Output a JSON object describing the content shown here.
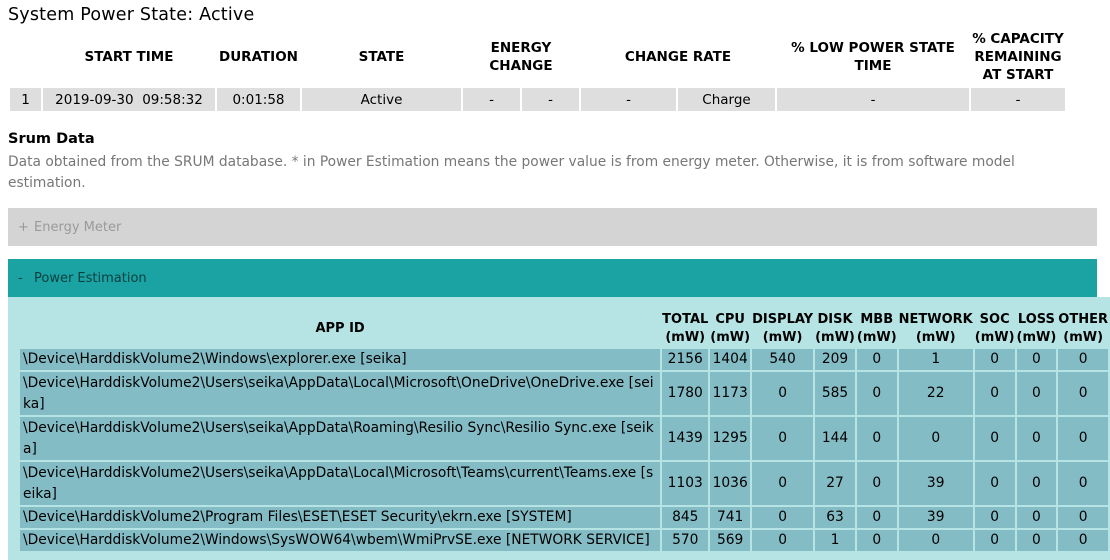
{
  "heading": "System Power State: Active",
  "state_table": {
    "columns": [
      "",
      "START TIME",
      "DURATION",
      "STATE",
      "ENERGY CHANGE",
      "",
      "CHANGE RATE",
      "",
      "% LOW POWER STATE TIME",
      "% CAPACITY REMAINING AT START"
    ],
    "row": {
      "index": "1",
      "start_time": "2019-09-30  09:58:32",
      "duration": "0:01:58",
      "state": "Active",
      "energy_change_a": "-",
      "energy_change_b": "-",
      "change_rate_a": "-",
      "change_rate_b": "Charge",
      "low_power_time": "-",
      "capacity_remaining": "-"
    }
  },
  "srum": {
    "title": "Srum Data",
    "description": "Data obtained from the SRUM database. * in Power Estimation means the power value is from energy meter. Otherwise, it is from software model estimation.",
    "energy_meter_panel": {
      "sign": "+",
      "label": "Energy Meter"
    },
    "power_estimation_panel": {
      "sign": "-",
      "label": "Power Estimation"
    },
    "table": {
      "columns": [
        "APP ID",
        "TOTAL (mW)",
        "CPU (mW)",
        "DISPLAY (mW)",
        "DISK (mW)",
        "MBB (mW)",
        "NETWORK (mW)",
        "SOC (mW)",
        "LOSS (mW)",
        "OTHER (mW)"
      ],
      "rows": [
        {
          "app": "\\Device\\HarddiskVolume2\\Windows\\explorer.exe [seika]",
          "total": "2156",
          "cpu": "1404",
          "display": "540",
          "disk": "209",
          "mbb": "0",
          "network": "1",
          "soc": "0",
          "loss": "0",
          "other": "0"
        },
        {
          "app": "\\Device\\HarddiskVolume2\\Users\\seika\\AppData\\Local\\Microsoft\\OneDrive\\OneDrive.exe [seika]",
          "total": "1780",
          "cpu": "1173",
          "display": "0",
          "disk": "585",
          "mbb": "0",
          "network": "22",
          "soc": "0",
          "loss": "0",
          "other": "0"
        },
        {
          "app": "\\Device\\HarddiskVolume2\\Users\\seika\\AppData\\Roaming\\Resilio Sync\\Resilio Sync.exe [seika]",
          "total": "1439",
          "cpu": "1295",
          "display": "0",
          "disk": "144",
          "mbb": "0",
          "network": "0",
          "soc": "0",
          "loss": "0",
          "other": "0"
        },
        {
          "app": "\\Device\\HarddiskVolume2\\Users\\seika\\AppData\\Local\\Microsoft\\Teams\\current\\Teams.exe [seika]",
          "total": "1103",
          "cpu": "1036",
          "display": "0",
          "disk": "27",
          "mbb": "0",
          "network": "39",
          "soc": "0",
          "loss": "0",
          "other": "0"
        },
        {
          "app": "\\Device\\HarddiskVolume2\\Program Files\\ESET\\ESET Security\\ekrn.exe [SYSTEM]",
          "total": "845",
          "cpu": "741",
          "display": "0",
          "disk": "63",
          "mbb": "0",
          "network": "39",
          "soc": "0",
          "loss": "0",
          "other": "0"
        },
        {
          "app": "\\Device\\HarddiskVolume2\\Windows\\SysWOW64\\wbem\\WmiPrvSE.exe [NETWORK SERVICE]",
          "total": "570",
          "cpu": "569",
          "display": "0",
          "disk": "1",
          "mbb": "0",
          "network": "0",
          "soc": "0",
          "loss": "0",
          "other": "0"
        }
      ]
    }
  },
  "colors": {
    "power_panel_header": "#1ba3a3",
    "power_panel_body": "#b6e4e4",
    "table_cell": "#84bcc6",
    "energy_panel": "#d4d4d4",
    "state_cell": "#dedede"
  }
}
